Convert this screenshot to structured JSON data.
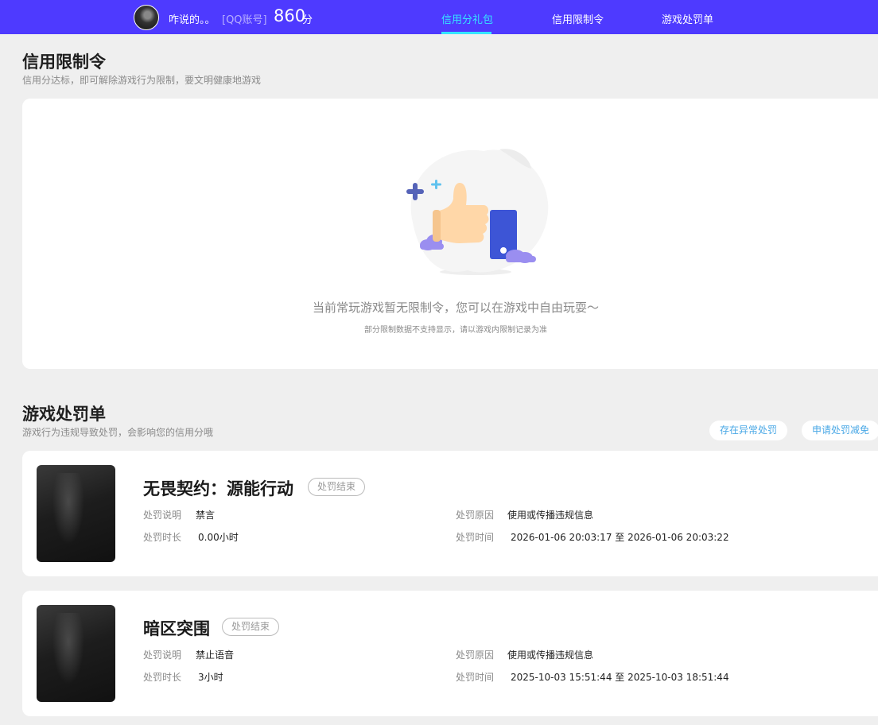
{
  "header": {
    "username": "咋说的。。",
    "account_tag": "[QQ账号]",
    "score": "860",
    "score_unit": "分",
    "nav": [
      "信用分礼包",
      "信用限制令",
      "游戏处罚单"
    ],
    "active_nav": "信用分礼包",
    "colors": {
      "bar": "#4e3aff",
      "active": "#35e6ff"
    }
  },
  "restriction": {
    "title": "信用限制令",
    "subtitle": "信用分达标，即可解除游戏行为限制，要文明健康地游戏",
    "empty_message": "当前常玩游戏暂无限制令，您可以在游戏中自由玩耍～",
    "empty_note": "部分限制数据不支持显示，请以游戏内限制记录为准",
    "illustration_icon": "thumbs-up-icon"
  },
  "penalties": {
    "title": "游戏处罚单",
    "subtitle": "游戏行为违规导致处罚，会影响您的信用分哦",
    "actions": [
      "存在异常处罚",
      "申请处罚减免"
    ],
    "labels": {
      "desc": "处罚说明",
      "duration": "处罚时长",
      "reason": "处罚原因",
      "time": "处罚时间",
      "to": "至"
    },
    "items": [
      {
        "game": "无畏契约：源能行动",
        "status": "处罚结束",
        "desc": "禁言",
        "duration": "0.00小时",
        "reason": "使用或传播违规信息",
        "time_from": "2026-01-06 20:03:17",
        "time_to": "2026-01-06 20:03:22"
      },
      {
        "game": "暗区突围",
        "status": "处罚结束",
        "desc": "禁止语音",
        "duration": "3小时",
        "reason": "使用或传播违规信息",
        "time_from": "2025-10-03 15:51:44",
        "time_to": "2025-10-03 18:51:44"
      }
    ]
  }
}
